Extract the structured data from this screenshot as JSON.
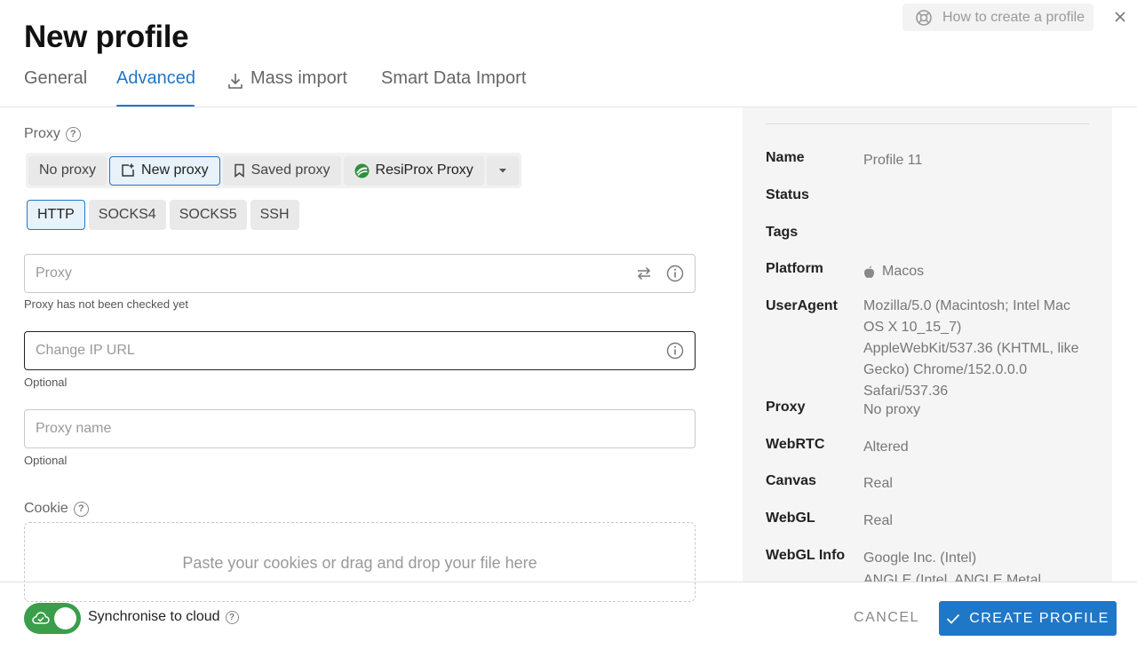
{
  "header": {
    "title": "New profile",
    "help_link": "How to create a profile",
    "close_icon": "close-icon"
  },
  "tabs": [
    {
      "label": "General",
      "active": false
    },
    {
      "label": "Advanced",
      "active": true
    },
    {
      "label": "Mass import",
      "active": false,
      "icon": "download-icon"
    },
    {
      "label": "Smart Data Import",
      "active": false
    }
  ],
  "proxy": {
    "label": "Proxy",
    "modes": [
      "No proxy",
      "New proxy",
      "Saved proxy",
      "ResiProx Proxy"
    ],
    "selected_mode": "New proxy",
    "types": [
      "HTTP",
      "SOCKS4",
      "SOCKS5",
      "SSH"
    ],
    "selected_type": "HTTP",
    "proxy_placeholder": "Proxy",
    "proxy_status": "Proxy has not been checked yet",
    "change_ip_placeholder": "Change IP URL",
    "change_ip_helper": "Optional",
    "proxy_name_placeholder": "Proxy name",
    "proxy_name_helper": "Optional"
  },
  "cookie": {
    "label": "Cookie",
    "dropzone_text": "Paste your cookies or drag and drop your file here"
  },
  "summary": {
    "rows": [
      {
        "key": "Name",
        "value": "Profile 11"
      },
      {
        "key": "Status",
        "value": ""
      },
      {
        "key": "Tags",
        "value": ""
      },
      {
        "key": "Platform",
        "value": "Macos"
      },
      {
        "key": "UserAgent",
        "value": "Mozilla/5.0 (Macintosh; Intel Mac OS X 10_15_7) AppleWebKit/537.36 (KHTML, like Gecko) Chrome/152.0.0.0 Safari/537.36"
      },
      {
        "key": "Proxy",
        "value": "No proxy"
      },
      {
        "key": "WebRTC",
        "value": "Altered"
      },
      {
        "key": "Canvas",
        "value": "Real"
      },
      {
        "key": "WebGL",
        "value": "Real"
      },
      {
        "key": "WebGL Info",
        "value": "Google Inc. (Intel)"
      },
      {
        "key": "",
        "value": "ANGLE (Intel, ANGLE Metal"
      }
    ]
  },
  "footer": {
    "sync_label": "Synchronise to cloud",
    "sync_enabled": true,
    "cancel_label": "CANCEL",
    "create_label": "CREATE PROFILE"
  },
  "colors": {
    "accent": "#1f77c8",
    "toggle_on": "#3a9e4a"
  }
}
